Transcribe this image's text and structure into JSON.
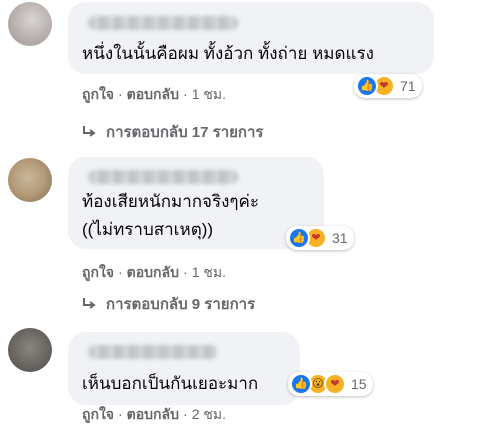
{
  "comments": [
    {
      "text_lines": [
        "หนึ่งในนั้นคือผม ทั้งอ้วก ทั้งถ่าย หมดแรง"
      ],
      "reactions": {
        "icons": [
          "like-icon",
          "care-icon"
        ],
        "count": "71"
      },
      "actions": {
        "like": "ถูกใจ",
        "reply": "ตอบกลับ",
        "time": "1 ชม."
      },
      "replies": "การตอบกลับ 17 รายการ"
    },
    {
      "text_lines": [
        "ท้องเสียหนักมากจริงๆค่ะ",
        "((ไม่ทราบสาเหตุ))"
      ],
      "reactions": {
        "icons": [
          "like-icon",
          "care-icon"
        ],
        "count": "31"
      },
      "actions": {
        "like": "ถูกใจ",
        "reply": "ตอบกลับ",
        "time": "1 ชม."
      },
      "replies": "การตอบกลับ 9 รายการ"
    },
    {
      "text_lines": [
        "เห็นบอกเป็นกันเยอะมาก"
      ],
      "reactions": {
        "icons": [
          "like-icon",
          "wow-icon",
          "care-icon"
        ],
        "count": "15"
      },
      "actions": {
        "like": "ถูกใจ",
        "reply": "ตอบกลับ",
        "time": "2 ชม."
      }
    }
  ],
  "separator": "·",
  "colors": {
    "bubble": "#f0f2f5",
    "meta_text": "#65676b",
    "like_blue": "#1877f2",
    "care_yellow": "#f7b125"
  }
}
